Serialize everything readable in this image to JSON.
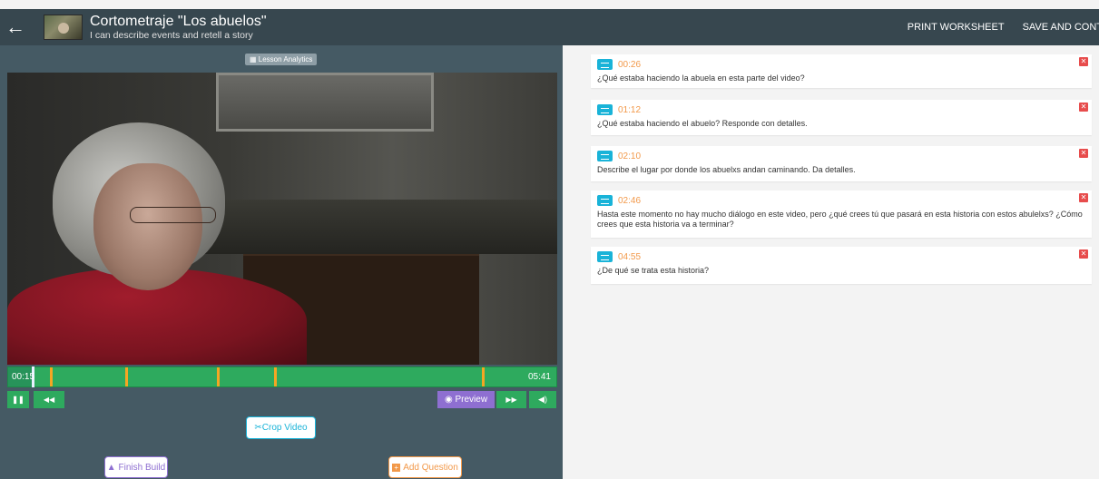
{
  "header": {
    "back_icon": "arrow-left-icon",
    "title": "Cortometraje \"Los abuelos\"",
    "subtitle": "I can describe events and retell a story",
    "print_label": "PRINT WORKSHEET",
    "save_label": "SAVE AND CONT"
  },
  "player": {
    "analytics_label": "Lesson Analytics",
    "current_time": "00:15",
    "duration": "05:41",
    "progress_fraction": 0.045,
    "marker_times": [
      "00:26",
      "01:12",
      "02:10",
      "02:46",
      "04:55"
    ],
    "pause_icon": "pause-icon",
    "rewind_icon": "skip-back-icon",
    "preview_label": "Preview",
    "forward_icon": "skip-forward-icon",
    "volume_icon": "volume-icon"
  },
  "builder": {
    "crop_label": "Crop Video",
    "finish_label": "Finish Build",
    "add_question_label": "Add Question"
  },
  "questions": [
    {
      "time": "00:26",
      "text": "¿Qué estaba haciendo la abuela en esta parte del video?"
    },
    {
      "time": "01:12",
      "text": "¿Qué estaba haciendo el abuelo? Responde con detalles."
    },
    {
      "time": "02:10",
      "text": "Describe el lugar por donde los abuelxs andan caminando. Da detalles."
    },
    {
      "time": "02:46",
      "text": "Hasta este momento no hay mucho diálogo en este video, pero ¿qué crees tú que pasará en esta historia con estos abulelxs? ¿Cómo crees que esta historia va a terminar?"
    },
    {
      "time": "04:55",
      "text": "¿De qué se trata esta historia?"
    }
  ],
  "colors": {
    "topbar": "#37474f",
    "panel": "#455a64",
    "timeline": "#2eaa5e",
    "marker": "#f5a623",
    "preview": "#8e6fd1",
    "question_icon": "#19b3d8",
    "time_text": "#f2994a",
    "delete": "#e74c4c"
  }
}
